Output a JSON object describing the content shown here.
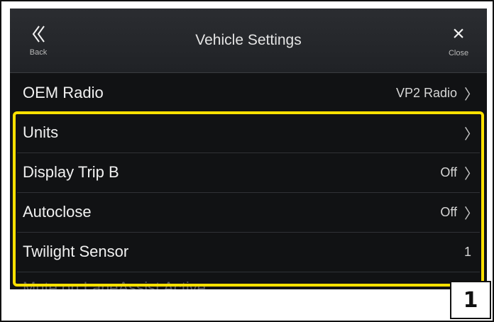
{
  "header": {
    "back_icon": "double-chevron-left",
    "back_label": "Back",
    "title": "Vehicle Settings",
    "close_icon": "×",
    "close_label": "Close"
  },
  "items": [
    {
      "label": "OEM Radio",
      "value": "VP2 Radio",
      "chevron": "〉"
    },
    {
      "label": "Units",
      "value": "",
      "chevron": "〉"
    },
    {
      "label": "Display Trip B",
      "value": "Off",
      "chevron": "〉"
    },
    {
      "label": "Autoclose",
      "value": "Off",
      "chevron": "〉"
    },
    {
      "label": "Twilight Sensor",
      "value": "1",
      "chevron": ""
    },
    {
      "label": "Mute on LaneAssist Active",
      "value": "",
      "chevron": ""
    }
  ],
  "callout_number": "1",
  "colors": {
    "highlight": "#ffe000",
    "background": "#111214",
    "header": "#2b2d31"
  }
}
